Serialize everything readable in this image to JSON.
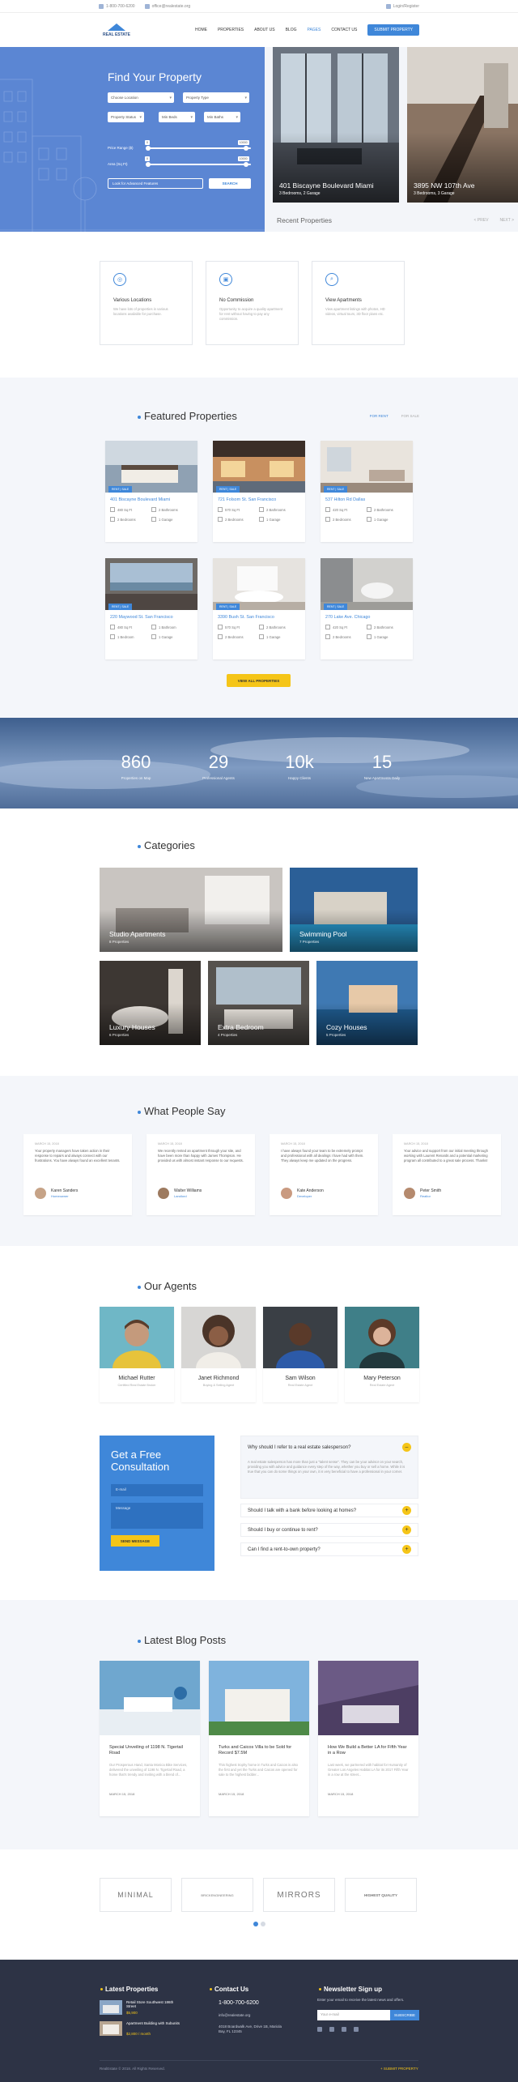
{
  "topbar": {
    "phone": "1-800-700-6200",
    "email": "office@realestate.org",
    "login": "Login/Register"
  },
  "header": {
    "logo_text": "REAL ESTATE",
    "nav": [
      "HOME",
      "PROPERTIES",
      "ABOUT US",
      "BLOG",
      "PAGES",
      "CONTACT US"
    ],
    "active_nav": "PAGES",
    "submit_label": "SUBMIT PROPERTY"
  },
  "hero": {
    "title": "Find Your Property",
    "selects": {
      "location": "Choose Location",
      "type": "Property Type",
      "status": "Property Status",
      "beds": "Min Beds",
      "baths": "Min Baths"
    },
    "price_label": "Price Range ($)",
    "price_min": "0",
    "price_max": "10000",
    "area_label": "Area (Sq Ft)",
    "area_min": "0",
    "area_max": "10000",
    "features_toggle": "Look for Advanced Features",
    "search_label": "SEARCH",
    "price_level": 0.95,
    "area_level": 0.95,
    "slides": [
      {
        "title": "401 Biscayne Boulevard Miami",
        "sub": "3 Bedrooms, 2 Garage"
      },
      {
        "title": "3895 NW 107th Ave",
        "sub": "3 Bedrooms, 3 Garage"
      }
    ],
    "recent_label": "Recent Properties",
    "prev_label": "< PREV",
    "next_label": "NEXT >"
  },
  "features": [
    {
      "icon": "map-pin-icon",
      "glyph": "◎",
      "title": "Various Locations",
      "text": "We have lots of properties in various locations available for purchase."
    },
    {
      "icon": "percent-icon",
      "glyph": "▣",
      "title": "No Commission",
      "text": "Opportunity to acquire a quality apartment for rent without having to pay any commission."
    },
    {
      "icon": "search-icon",
      "glyph": "⌕",
      "title": "View Apartments",
      "text": "View apartment listings with photos, HD videos, virtual tours, 3D floor plans etc."
    }
  ],
  "featured": {
    "title": "Featured Properties",
    "tab_rent": "FOR RENT",
    "tab_sale": "FOR SALE",
    "cards": [
      {
        "badge": "RENT | SALE",
        "title": "401 Biscayne Boulevard Miami",
        "area": "480 Sq Ft",
        "bath": "2 Bathrooms",
        "beds": "2 Bedrooms",
        "garage": "1 Garage"
      },
      {
        "badge": "RENT | SALE",
        "title": "721 Folsom St. San Francisco",
        "area": "570 Sq Ft",
        "bath": "2 Bathrooms",
        "beds": "2 Bedrooms",
        "garage": "1 Garage"
      },
      {
        "badge": "RENT | SALE",
        "title": "537 Hilton Rd Dallas",
        "area": "420 Sq Ft",
        "bath": "2 Bathrooms",
        "beds": "2 Bedrooms",
        "garage": "1 Garage"
      },
      {
        "badge": "RENT | SALE",
        "title": "220 Maywood St. San Francisco",
        "area": "480 Sq Ft",
        "bath": "1 Bathroom",
        "beds": "1 Bedroom",
        "garage": "1 Garage"
      },
      {
        "badge": "RENT | SALE",
        "title": "3390 Bush St. San Francisco",
        "area": "570 Sq Ft",
        "bath": "2 Bathrooms",
        "beds": "2 Bedrooms",
        "garage": "1 Garage"
      },
      {
        "badge": "RENT | SALE",
        "title": "270 Lake Ave. Chicago",
        "area": "420 Sq Ft",
        "bath": "2 Bathrooms",
        "beds": "2 Bedrooms",
        "garage": "1 Garage"
      }
    ],
    "view_all": "VIEW ALL PROPERTIES"
  },
  "stats": [
    {
      "num": "860",
      "label": "Properties on Map"
    },
    {
      "num": "29",
      "label": "Professional Agents"
    },
    {
      "num": "10k",
      "label": "Happy Clients"
    },
    {
      "num": "15",
      "label": "New Apartments Daily"
    }
  ],
  "categories": {
    "title": "Categories",
    "items": [
      {
        "title": "Studio Apartments",
        "sub": "8 Properties"
      },
      {
        "title": "Swimming Pool",
        "sub": "7 Properties"
      },
      {
        "title": "Luxury Houses",
        "sub": "6 Properties"
      },
      {
        "title": "Extra Bedroom",
        "sub": "4 Properties"
      },
      {
        "title": "Cozy Houses",
        "sub": "5 Properties"
      }
    ]
  },
  "testimonials": {
    "title": "What People Say",
    "items": [
      {
        "date": "MARCH 15, 2018",
        "quote": "Your property managers have taken action in their response to repairs and always connect with our frustrations. You have always found an excellent tenants.",
        "name": "Karen Sanders",
        "role": "Homeowner"
      },
      {
        "date": "MARCH 15, 2018",
        "quote": "We recently rented an apartment through your site, and have been more than happy with James Thompson. He provided us with almost instant response to our requests.",
        "name": "Walter Williams",
        "role": "Landlord"
      },
      {
        "date": "MARCH 15, 2018",
        "quote": "I have always found your team to be extremely prompt and professional with all dealings I have had with them. They always keep me updated on the progress.",
        "name": "Kate Anderson",
        "role": "Developer"
      },
      {
        "date": "MARCH 15, 2018",
        "quote": "Your advice and support from our initial meeting through working with Laurent Renards and a potential marketing program all contributed to a great sale process. Thanks!",
        "name": "Peter Smith",
        "role": "Realtor"
      }
    ]
  },
  "agents": {
    "title": "Our Agents",
    "items": [
      {
        "name": "Michael Rutter",
        "role": "Certified Real Estate Broker"
      },
      {
        "name": "Janet Richmond",
        "role": "Buying & Selling Agent"
      },
      {
        "name": "Sam Wilson",
        "role": "Real Estate Agent"
      },
      {
        "name": "Mary Peterson",
        "role": "Real Estate Agent"
      }
    ]
  },
  "consultation": {
    "title": "Get a Free Consultation",
    "email_placeholder": "E-mail",
    "message_placeholder": "Message",
    "send": "SEND MESSAGE"
  },
  "faq": [
    {
      "q": "Why should I refer to a real estate salesperson?",
      "a": "A real estate salesperson has more than just a \"talent sense\". They can be your advisor on your search, providing you with advice and guidance every step of the way, whether you buy or sell a home. While it is true that you can do some things on your own, it is very beneficial to have a professional in your corner.",
      "open": true
    },
    {
      "q": "Should I talk with a bank before looking at homes?",
      "a": ""
    },
    {
      "q": "Should I buy or continue to rent?",
      "a": ""
    },
    {
      "q": "Can I find a rent-to-own property?",
      "a": ""
    }
  ],
  "blog": {
    "title": "Latest Blog Posts",
    "items": [
      {
        "title": "Special Unveiling of 1198 N. Tigertail Road",
        "text": "Our Prosperous Hand, Santa Monica Bike Services, delivered the unveiling of 1198 N. Tigertail Road, a home that's trendy and inviting with a blend of...",
        "date": "MARCH 15, 2018"
      },
      {
        "title": "Turks and Caicos Villa to be Sold for Record $7.5M",
        "text": "This highest trophy home in Turks and Caicos is also the first and yet the Turks and Caicos are opened for sale to the highest bidder...",
        "date": "MARCH 15, 2018"
      },
      {
        "title": "How We Build a Better LA for Fifth Year in a Row",
        "text": "Last week, we partnered with habitat for Humanity of Greater Los Angeles Habitat LA for its 2017 Fifth Year in a row at the street...",
        "date": "MARCH 15, 2018"
      }
    ]
  },
  "partners": [
    "MINIMAL",
    "BRICKENGINEERING",
    "MIRRORS",
    "HIGHEST QUALITY"
  ],
  "footer": {
    "props_title": "Latest Properties",
    "props": [
      {
        "title": "Retail Store Southwest 186th Street",
        "price": "$5,900"
      },
      {
        "title": "Apartment Building with Subunits",
        "price": "$2,800 / month"
      }
    ],
    "contact_title": "Contact Us",
    "phone": "1-800-700-6200",
    "email": "info@realestate.org",
    "address": "4018 Boardwalk Ave, Drive 1B, Mariola Bay, FL 12345",
    "newsletter_title": "Newsletter Sign up",
    "newsletter_text": "Enter your email to receive the latest news and offers.",
    "newsletter_placeholder": "Your e-mail",
    "subscribe": "SUBSCRIBE",
    "copyright": "RealEstate © 2018. All Rights Reserved.",
    "submit": "+ SUBMIT PROPERTY"
  }
}
